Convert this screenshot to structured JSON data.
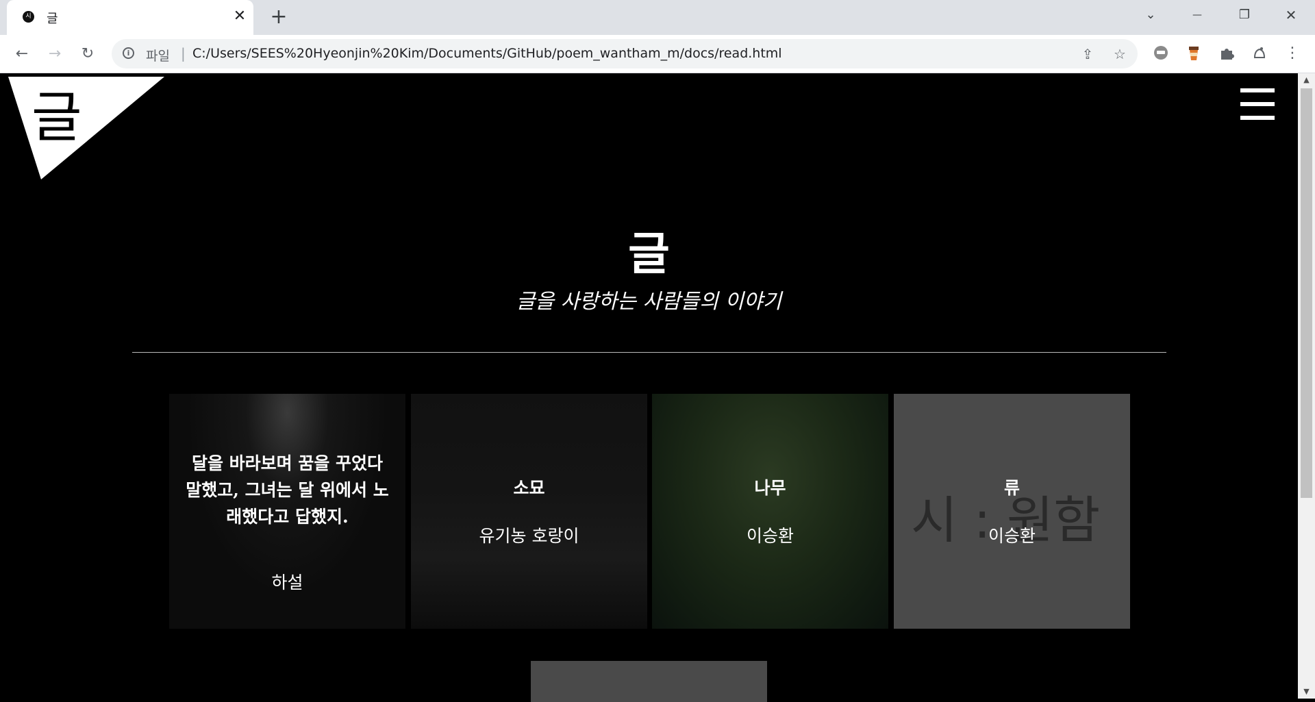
{
  "browser": {
    "tab": {
      "favicon": "시",
      "title": "글",
      "close": "✕"
    },
    "new_tab": "+",
    "window_controls": {
      "tab_search": "⌄",
      "minimize": "—",
      "restore": "❐",
      "close": "✕"
    },
    "nav": {
      "back": "←",
      "forward": "→",
      "reload": "↻"
    },
    "omnibox": {
      "scheme_label": "파일",
      "separator": "|",
      "url": "C:/Users/SEES%20Hyeonjin%20Kim/Documents/GitHub/poem_wantham_m/docs/read.html",
      "share_icon": "⇪",
      "bookmark_icon": "☆"
    },
    "extensions": [
      "ext-badge-icon",
      "coffee-icon",
      "puzzle-icon",
      "profile-icon",
      "menu-dots-icon"
    ],
    "menu_dots": "⋮"
  },
  "page": {
    "logo_char": "글",
    "hero": {
      "title": "글",
      "subtitle": "글을 사랑하는 사람들의 이야기"
    },
    "cards": [
      {
        "title": "달을 바라보며 꿈을 꾸었다 말했고, 그녀는 달 위에서 노래했다고 답했지.",
        "author": "하설",
        "bg": "#0f0f0f"
      },
      {
        "title": "소묘",
        "author": "유기농 호랑이",
        "bg": "#141414"
      },
      {
        "title": "나무",
        "author": "이승환",
        "bg": "#1b2316"
      },
      {
        "title": "류",
        "author": "이승환",
        "bg": "#4a4a4a",
        "watermark": "시 : 원함"
      }
    ]
  },
  "scrollbar": {
    "up": "▲",
    "down": "▼"
  }
}
